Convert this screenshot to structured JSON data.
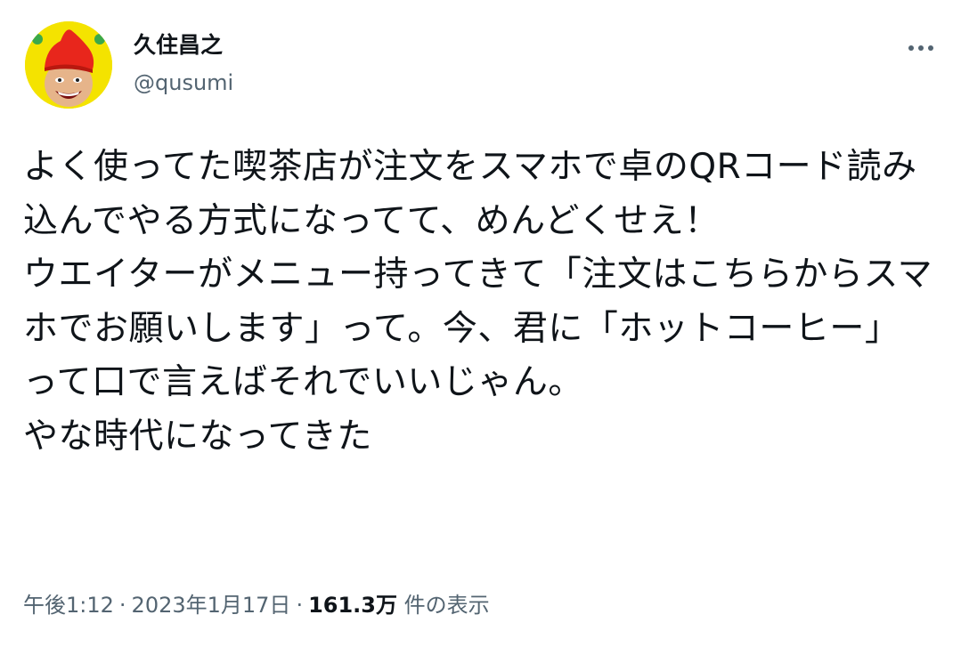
{
  "author": {
    "display_name": "久住昌之",
    "handle": "@qusumi",
    "avatar_icon": "avatar-person-red-hat"
  },
  "more_icon": "more-dots-icon",
  "tweet": {
    "text": "よく使ってた喫茶店が注文をスマホで卓のQRコード読み込んでやる方式になってて、めんどくせえ！\nウエイターがメニュー持ってきて「注文はこちらからスマホでお願いします」って。今、君に「ホットコーヒー」って口で言えばそれでいいじゃん。\nやな時代になってきた"
  },
  "meta": {
    "time": "午後1:12",
    "separator": "·",
    "date": "2023年1月17日",
    "views_count": "161.3万",
    "views_label": "件の表示"
  },
  "colors": {
    "primary_text": "#0f1419",
    "secondary_text": "#536471",
    "avatar_bg": "#f4e300",
    "hat_red": "#e8261c"
  }
}
